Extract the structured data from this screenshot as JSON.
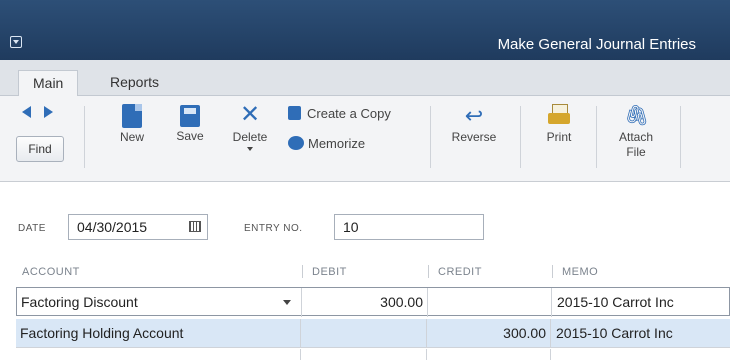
{
  "window": {
    "title": "Make General Journal Entries"
  },
  "tabs": [
    {
      "label": "Main"
    },
    {
      "label": "Reports"
    }
  ],
  "toolbar": {
    "find": "Find",
    "new": "New",
    "save": "Save",
    "delete": "Delete",
    "create_copy": "Create a Copy",
    "memorize": "Memorize",
    "reverse": "Reverse",
    "print": "Print",
    "attach_line1": "Attach",
    "attach_line2": "File"
  },
  "form": {
    "date_label": "DATE",
    "date_value": "04/30/2015",
    "entry_label": "ENTRY NO.",
    "entry_value": "10"
  },
  "grid": {
    "headers": {
      "account": "ACCOUNT",
      "debit": "DEBIT",
      "credit": "CREDIT",
      "memo": "MEMO"
    },
    "rows": [
      {
        "account": "Factoring Discount",
        "debit": "300.00",
        "credit": "",
        "memo": "2015-10 Carrot Inc"
      },
      {
        "account": "Factoring Holding Account",
        "debit": "",
        "credit": "300.00",
        "memo": "2015-10 Carrot Inc"
      }
    ]
  },
  "colors": {
    "titlebar": "#1f3b5e",
    "accent": "#2f6db7",
    "selected_row": "#d9e7f6"
  }
}
